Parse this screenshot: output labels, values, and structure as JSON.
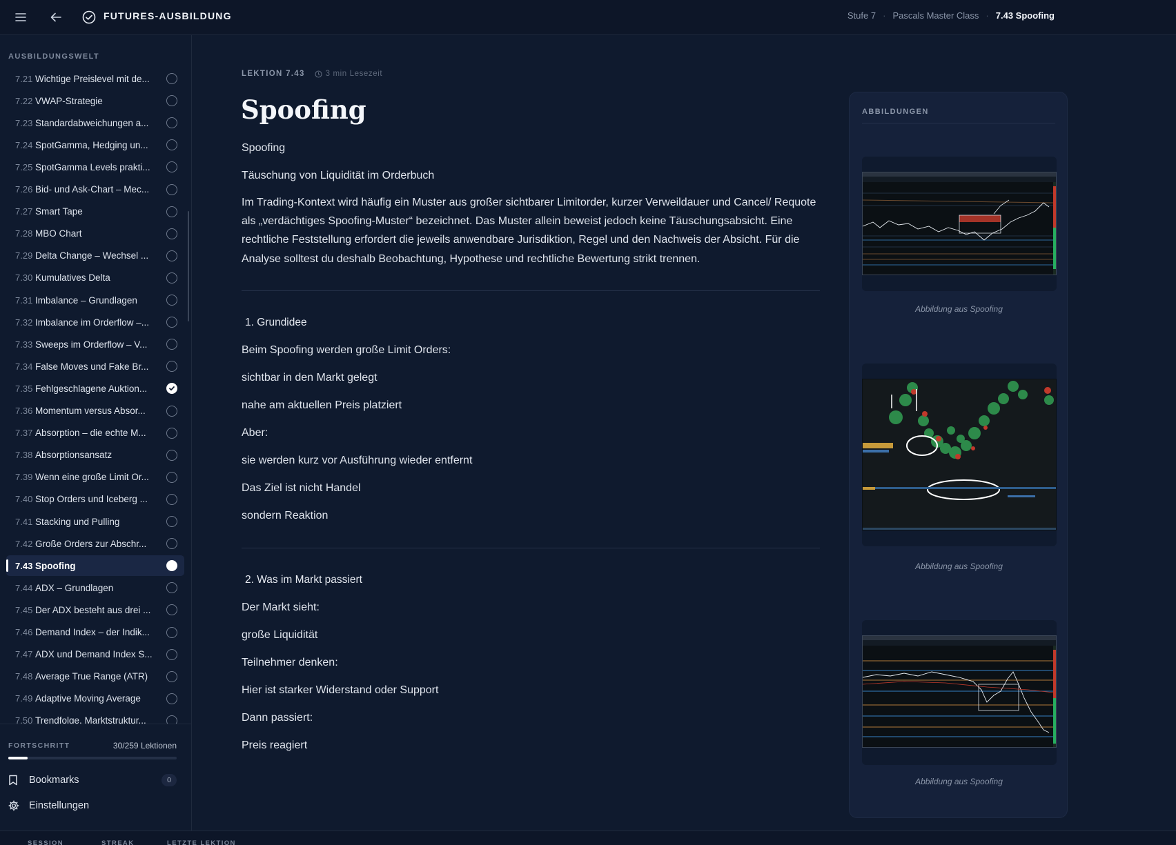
{
  "header": {
    "brand": "FUTURES-AUSBILDUNG",
    "breadcrumb": [
      "Stufe 7",
      "Pascals Master Class",
      "7.43 Spoofing"
    ]
  },
  "sidebar": {
    "heading": "AUSBILDUNGSWELT",
    "lessons": [
      {
        "num": "7.21",
        "title": "Wichtige Preislevel mit de...",
        "status": "open"
      },
      {
        "num": "7.22",
        "title": "VWAP-Strategie",
        "status": "open"
      },
      {
        "num": "7.23",
        "title": "Standardabweichungen a...",
        "status": "open"
      },
      {
        "num": "7.24",
        "title": "SpotGamma, Hedging un...",
        "status": "open"
      },
      {
        "num": "7.25",
        "title": "SpotGamma Levels prakti...",
        "status": "open"
      },
      {
        "num": "7.26",
        "title": "Bid- und Ask-Chart – Mec...",
        "status": "open"
      },
      {
        "num": "7.27",
        "title": "Smart Tape",
        "status": "open"
      },
      {
        "num": "7.28",
        "title": "MBO Chart",
        "status": "open"
      },
      {
        "num": "7.29",
        "title": "Delta Change – Wechsel ...",
        "status": "open"
      },
      {
        "num": "7.30",
        "title": "Kumulatives Delta",
        "status": "open"
      },
      {
        "num": "7.31",
        "title": "Imbalance – Grundlagen",
        "status": "open"
      },
      {
        "num": "7.32",
        "title": "Imbalance im Orderflow –...",
        "status": "open"
      },
      {
        "num": "7.33",
        "title": "Sweeps im Orderflow – V...",
        "status": "open"
      },
      {
        "num": "7.34",
        "title": "False Moves und Fake Br...",
        "status": "open"
      },
      {
        "num": "7.35",
        "title": "Fehlgeschlagene Auktion...",
        "status": "done"
      },
      {
        "num": "7.36",
        "title": "Momentum versus Absor...",
        "status": "open"
      },
      {
        "num": "7.37",
        "title": "Absorption – die echte M...",
        "status": "open"
      },
      {
        "num": "7.38",
        "title": "Absorptionsansatz",
        "status": "open"
      },
      {
        "num": "7.39",
        "title": "Wenn eine große Limit Or...",
        "status": "open"
      },
      {
        "num": "7.40",
        "title": "Stop Orders und Iceberg ...",
        "status": "open"
      },
      {
        "num": "7.41",
        "title": "Stacking und Pulling",
        "status": "open"
      },
      {
        "num": "7.42",
        "title": "Große Orders zur Abschr...",
        "status": "open"
      },
      {
        "num": "7.43",
        "title": "Spoofing",
        "status": "active"
      },
      {
        "num": "7.44",
        "title": "ADX – Grundlagen",
        "status": "open"
      },
      {
        "num": "7.45",
        "title": "Der ADX besteht aus drei ...",
        "status": "open"
      },
      {
        "num": "7.46",
        "title": "Demand Index – der Indik...",
        "status": "open"
      },
      {
        "num": "7.47",
        "title": "ADX und Demand Index S...",
        "status": "open"
      },
      {
        "num": "7.48",
        "title": "Average True Range (ATR)",
        "status": "open"
      },
      {
        "num": "7.49",
        "title": "Adaptive Moving Average",
        "status": "open"
      },
      {
        "num": "7.50",
        "title": "Trendfolge, Marktstruktur...",
        "status": "open"
      }
    ],
    "progress": {
      "label": "FORTSCHRITT",
      "count": "30/259 Lektionen",
      "fraction": 0.116
    },
    "bookmarks": {
      "label": "Bookmarks",
      "count": "0"
    },
    "settings": {
      "label": "Einstellungen"
    }
  },
  "lesson": {
    "label": "LEKTION 7.43",
    "read_time": "3 min Lesezeit",
    "title": "Spoofing",
    "intro": [
      "Spoofing",
      "Täuschung von Liquidität im Orderbuch",
      "Im Trading-Kontext wird häufig ein Muster aus großer sichtbarer Limitorder, kurzer Verweildauer und Cancel/ Requote als „verdächtiges Spoofing-Muster“ bezeichnet. Das Muster allein beweist jedoch keine Täuschungsabsicht. Eine rechtliche Feststellung erfordert die jeweils anwendbare Jurisdiktion, Regel und den Nachweis der Absicht. Für die Analyse solltest du deshalb Beobachtung, Hypothese und rechtliche Bewertung strikt trennen."
    ],
    "section1": {
      "heading": "1. Grundidee",
      "lines": [
        "Beim Spoofing werden große Limit Orders:",
        "sichtbar in den Markt gelegt",
        "nahe am aktuellen Preis platziert",
        "Aber:",
        "sie werden kurz vor Ausführung wieder entfernt",
        "Das Ziel ist nicht Handel",
        "sondern Reaktion"
      ]
    },
    "section2": {
      "heading": "2. Was im Markt passiert",
      "lines": [
        "Der Markt sieht:",
        "große Liquidität",
        "Teilnehmer denken:",
        "Hier ist starker Widerstand oder Support",
        "Dann passiert:",
        "Preis reagiert"
      ]
    }
  },
  "figures": {
    "heading": "ABBILDUNGEN",
    "items": [
      {
        "caption": "Abbildung aus Spoofing"
      },
      {
        "caption": "Abbildung aus Spoofing"
      },
      {
        "caption": "Abbildung aus Spoofing"
      }
    ]
  },
  "statbar": {
    "session": "SESSION",
    "streak": "STREAK",
    "last": "LETZTE LEKTION"
  }
}
